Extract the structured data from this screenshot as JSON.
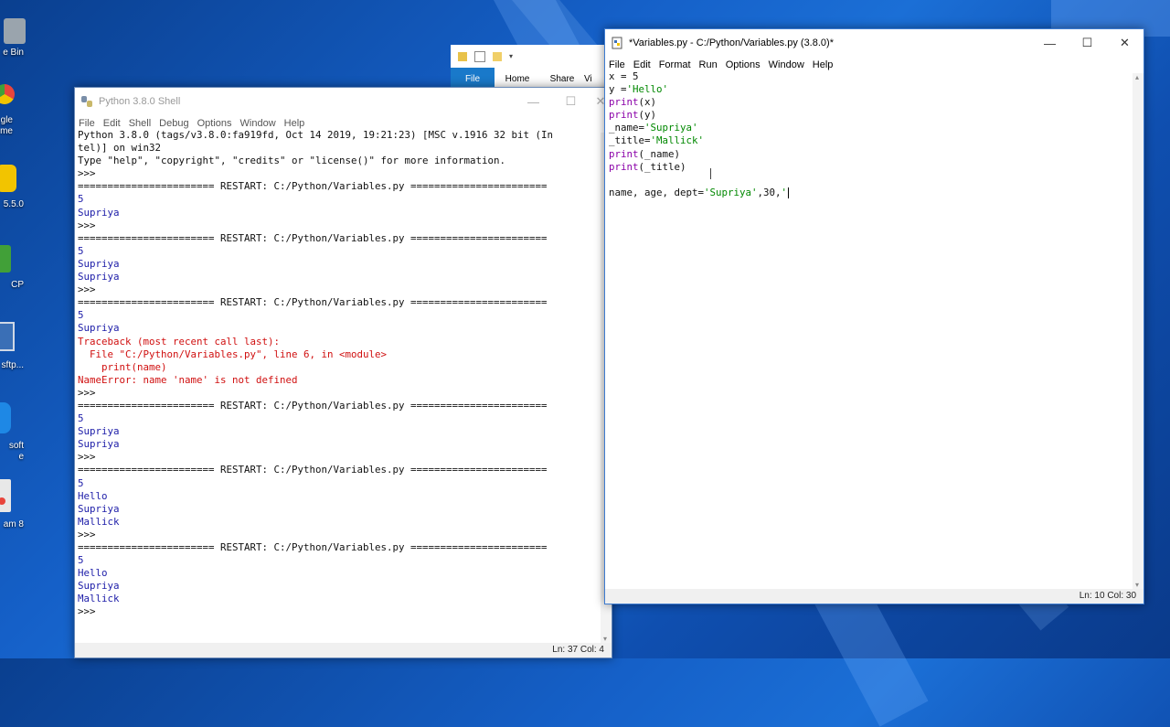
{
  "desktop": {
    "icons": [
      {
        "label": "e Bin",
        "color": "#9aa4ad"
      },
      {
        "label": "gle\nme",
        "color": "#e8453c"
      },
      {
        "label": "5.5.0",
        "color": "#f2c400"
      },
      {
        "label": "CP",
        "color": "#41a038"
      },
      {
        "label": "sftp...",
        "color": "#3a6fb6"
      },
      {
        "label": "soft\ne",
        "color": "#1e88e5"
      },
      {
        "label": "am 8",
        "color": "#e8e8e8"
      }
    ]
  },
  "explorer": {
    "tabs": [
      "File",
      "Home",
      "Share",
      "Vi"
    ]
  },
  "shell": {
    "title": "Python 3.8.0 Shell",
    "menu": [
      "File",
      "Edit",
      "Shell",
      "Debug",
      "Options",
      "Window",
      "Help"
    ],
    "lines": [
      {
        "text": "Python 3.8.0 (tags/v3.8.0:fa919fd, Oct 14 2019, 19:21:23) [MSC v.1916 32 bit (In",
        "cls": "black"
      },
      {
        "text": "tel)] on win32",
        "cls": "black"
      },
      {
        "text": "Type \"help\", \"copyright\", \"credits\" or \"license()\" for more information.",
        "cls": "black"
      },
      {
        "text": ">>> ",
        "cls": "black"
      },
      {
        "text": "======================= RESTART: C:/Python/Variables.py =======================",
        "cls": "black"
      },
      {
        "text": "5",
        "cls": "blue"
      },
      {
        "text": "Supriya",
        "cls": "blue"
      },
      {
        "text": ">>> ",
        "cls": "black"
      },
      {
        "text": "======================= RESTART: C:/Python/Variables.py =======================",
        "cls": "black"
      },
      {
        "text": "5",
        "cls": "blue"
      },
      {
        "text": "Supriya",
        "cls": "blue"
      },
      {
        "text": "Supriya",
        "cls": "blue"
      },
      {
        "text": ">>> ",
        "cls": "black"
      },
      {
        "text": "======================= RESTART: C:/Python/Variables.py =======================",
        "cls": "black"
      },
      {
        "text": "5",
        "cls": "blue"
      },
      {
        "text": "Supriya",
        "cls": "blue"
      },
      {
        "text": "Traceback (most recent call last):",
        "cls": "red"
      },
      {
        "text": "  File \"C:/Python/Variables.py\", line 6, in <module>",
        "cls": "red"
      },
      {
        "text": "    print(name)",
        "cls": "red"
      },
      {
        "text": "NameError: name 'name' is not defined",
        "cls": "red"
      },
      {
        "text": ">>> ",
        "cls": "black"
      },
      {
        "text": "======================= RESTART: C:/Python/Variables.py =======================",
        "cls": "black"
      },
      {
        "text": "5",
        "cls": "blue"
      },
      {
        "text": "Supriya",
        "cls": "blue"
      },
      {
        "text": "Supriya",
        "cls": "blue"
      },
      {
        "text": ">>> ",
        "cls": "black"
      },
      {
        "text": "======================= RESTART: C:/Python/Variables.py =======================",
        "cls": "black"
      },
      {
        "text": "5",
        "cls": "blue"
      },
      {
        "text": "Hello",
        "cls": "blue"
      },
      {
        "text": "Supriya",
        "cls": "blue"
      },
      {
        "text": "Mallick",
        "cls": "blue"
      },
      {
        "text": ">>> ",
        "cls": "black"
      },
      {
        "text": "======================= RESTART: C:/Python/Variables.py =======================",
        "cls": "black"
      },
      {
        "text": "5",
        "cls": "blue"
      },
      {
        "text": "Hello",
        "cls": "blue"
      },
      {
        "text": "Supriya",
        "cls": "blue"
      },
      {
        "text": "Mallick",
        "cls": "blue"
      },
      {
        "text": ">>> ",
        "cls": "black"
      }
    ],
    "status": "Ln: 37  Col: 4"
  },
  "editor": {
    "title": "*Variables.py - C:/Python/Variables.py (3.8.0)*",
    "menu": [
      "File",
      "Edit",
      "Format",
      "Run",
      "Options",
      "Window",
      "Help"
    ],
    "lines": [
      [
        {
          "t": "x = 5",
          "c": "black"
        }
      ],
      [
        {
          "t": "y =",
          "c": "black"
        },
        {
          "t": "'Hello'",
          "c": "green"
        }
      ],
      [
        {
          "t": "print",
          "c": "purple"
        },
        {
          "t": "(x)",
          "c": "black"
        }
      ],
      [
        {
          "t": "print",
          "c": "purple"
        },
        {
          "t": "(y)",
          "c": "black"
        }
      ],
      [
        {
          "t": "_name=",
          "c": "black"
        },
        {
          "t": "'Supriya'",
          "c": "green"
        }
      ],
      [
        {
          "t": "_title=",
          "c": "black"
        },
        {
          "t": "'Mallick'",
          "c": "green"
        }
      ],
      [
        {
          "t": "print",
          "c": "purple"
        },
        {
          "t": "(_name)",
          "c": "black"
        }
      ],
      [
        {
          "t": "print",
          "c": "purple"
        },
        {
          "t": "(_title)",
          "c": "black"
        }
      ],
      [
        {
          "t": "",
          "c": "black"
        }
      ],
      [
        {
          "t": "name, age, dept=",
          "c": "black"
        },
        {
          "t": "'Supriya'",
          "c": "green"
        },
        {
          "t": ",30,",
          "c": "black"
        },
        {
          "t": "'",
          "c": "green"
        }
      ]
    ],
    "status": "Ln: 10  Col: 30"
  }
}
